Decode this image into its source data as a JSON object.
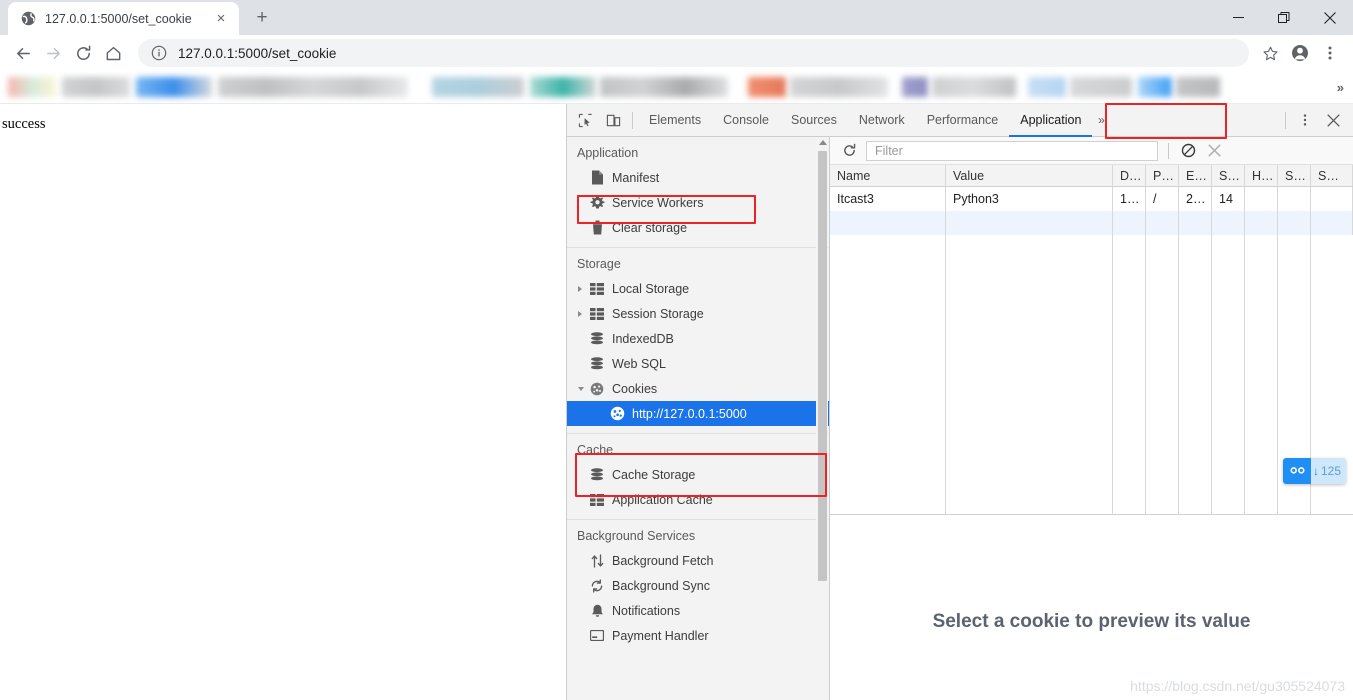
{
  "browser": {
    "tab": {
      "title": "127.0.0.1:5000/set_cookie",
      "favicon": "globe-icon",
      "close": "×"
    },
    "new_tab_label": "+",
    "window_controls": {
      "minimize": "—",
      "maximize": "❐",
      "close": "✕"
    },
    "toolbar": {
      "back": "←",
      "forward": "→",
      "reload": "⟳",
      "home": "⌂",
      "url": "127.0.0.1:5000/set_cookie",
      "info_icon": "info-circle-icon",
      "bookmark_star": "☆",
      "profile": "profile-avatar-icon",
      "menu": "⋮"
    },
    "bookmarks_overflow": "»"
  },
  "page": {
    "body_text": "success"
  },
  "devtools": {
    "tabs": [
      {
        "label": "Elements",
        "active": false
      },
      {
        "label": "Console",
        "active": false
      },
      {
        "label": "Sources",
        "active": false
      },
      {
        "label": "Network",
        "active": false
      },
      {
        "label": "Performance",
        "active": false
      },
      {
        "label": "Application",
        "active": true
      }
    ],
    "tabs_overflow": "»",
    "inspect_icon": "inspect-element-icon",
    "device_icon": "device-toolbar-icon",
    "more_icon": "⋮",
    "close_icon": "✕",
    "sidebar": {
      "groups": [
        {
          "title": "Application",
          "items": [
            {
              "label": "Manifest",
              "icon": "document-icon",
              "indent": 1
            },
            {
              "label": "Service Workers",
              "icon": "gear-icon",
              "indent": 1
            },
            {
              "label": "Clear storage",
              "icon": "trash-icon",
              "indent": 1
            }
          ]
        },
        {
          "title": "Storage",
          "items": [
            {
              "label": "Local Storage",
              "icon": "table-icon",
              "indent": 1,
              "arrow": "closed"
            },
            {
              "label": "Session Storage",
              "icon": "table-icon",
              "indent": 1,
              "arrow": "closed"
            },
            {
              "label": "IndexedDB",
              "icon": "database-icon",
              "indent": 1
            },
            {
              "label": "Web SQL",
              "icon": "database-icon",
              "indent": 1
            },
            {
              "label": "Cookies",
              "icon": "cookie-icon",
              "indent": 1,
              "arrow": "open"
            },
            {
              "label": "http://127.0.0.1:5000",
              "icon": "cookie-icon",
              "indent": 2,
              "selected": true
            }
          ]
        },
        {
          "title": "Cache",
          "items": [
            {
              "label": "Cache Storage",
              "icon": "database-icon",
              "indent": 1
            },
            {
              "label": "Application Cache",
              "icon": "table-icon",
              "indent": 1
            }
          ]
        },
        {
          "title": "Background Services",
          "items": [
            {
              "label": "Background Fetch",
              "icon": "updown-arrows-icon",
              "indent": 1
            },
            {
              "label": "Background Sync",
              "icon": "sync-icon",
              "indent": 1
            },
            {
              "label": "Notifications",
              "icon": "bell-icon",
              "indent": 1
            },
            {
              "label": "Payment Handler",
              "icon": "card-icon",
              "indent": 1
            }
          ]
        }
      ]
    },
    "cookies_panel": {
      "refresh_icon": "refresh-icon",
      "filter_placeholder": "Filter",
      "clear_all_icon": "clear-all-icon",
      "delete_icon": "✕",
      "columns": [
        "Name",
        "Value",
        "D…",
        "P…",
        "E…",
        "S…",
        "H…",
        "S…",
        "S…"
      ],
      "rows": [
        {
          "name": "Itcast3",
          "value": "Python3",
          "domain": "1…",
          "path": "/",
          "expires": "2…",
          "size": "14",
          "httponly": "",
          "secure": "",
          "samesite": ""
        }
      ],
      "preview_message": "Select a cookie to preview its value"
    }
  },
  "watermark": "https://blog.csdn.net/gu305524073",
  "download_badge": {
    "count": "125",
    "arrow": "↓",
    "icon": "download-manager-icon"
  },
  "colors": {
    "accent": "#1a73e8",
    "annotation": "#ee2222",
    "chrome_bg": "#dee1e6",
    "devtools_bg": "#f3f3f3",
    "badge_blue": "#1f8ff5"
  }
}
